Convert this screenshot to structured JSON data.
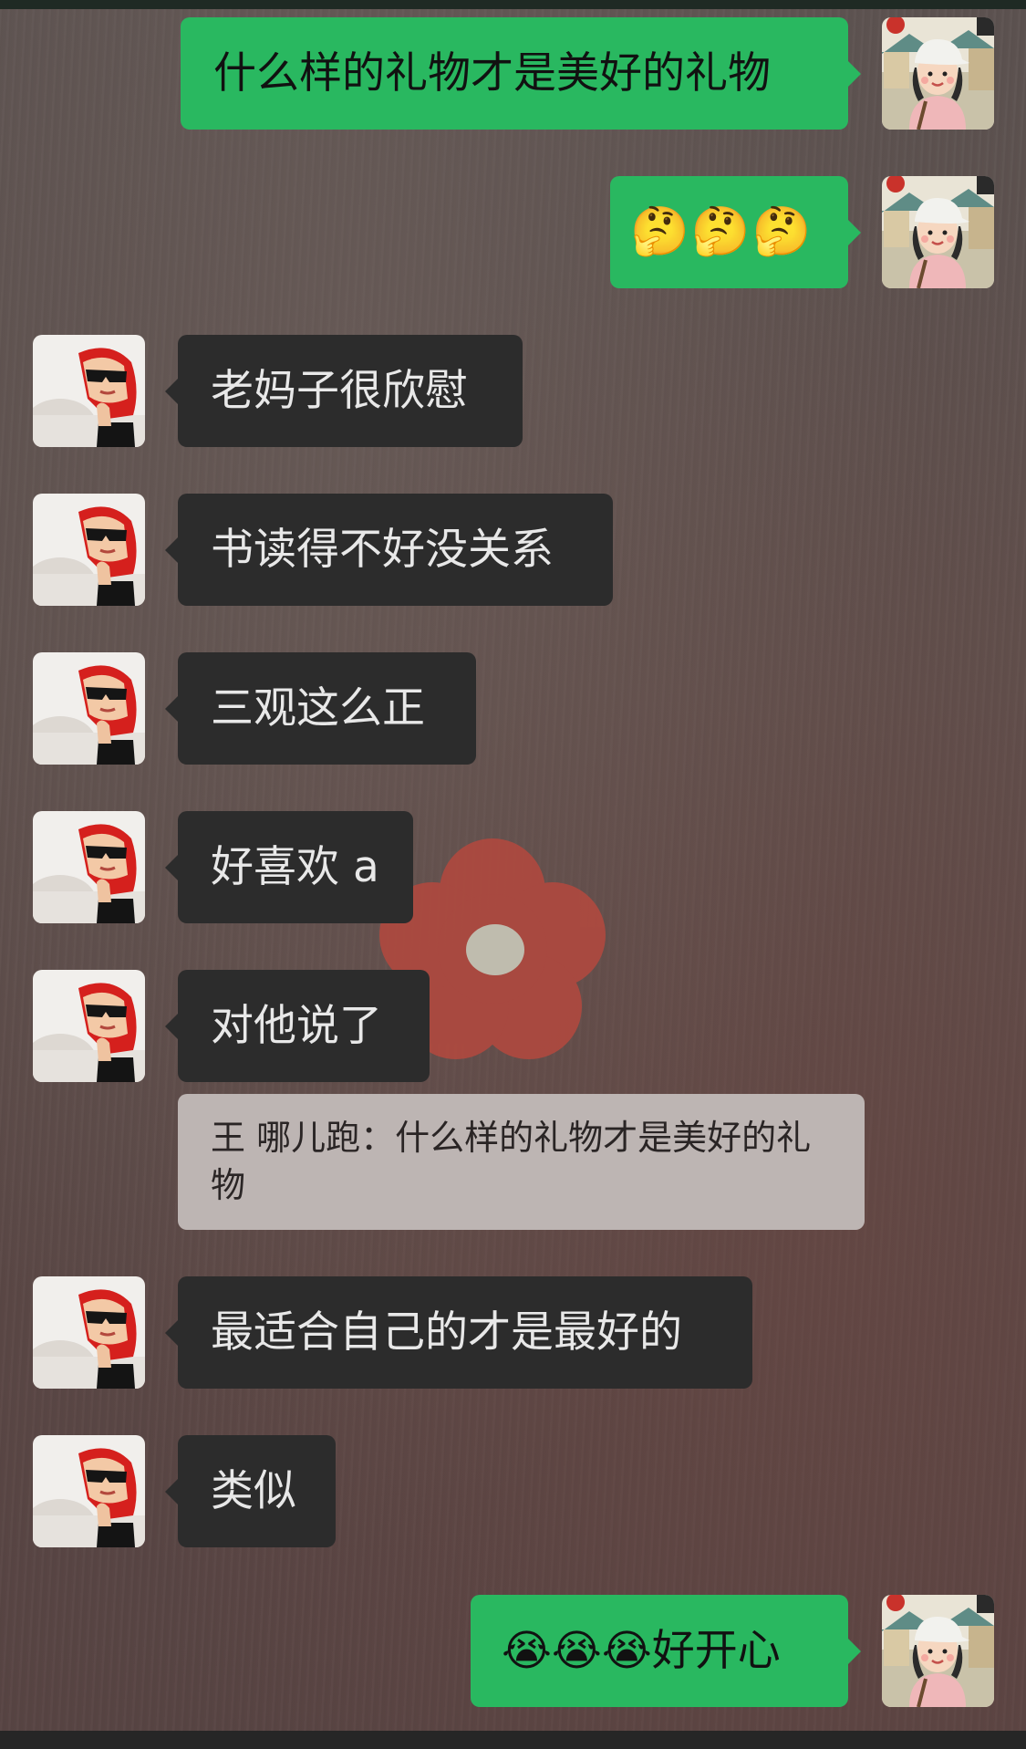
{
  "messages": [
    {
      "side": "me",
      "text": "什么样的礼物才是美好的礼物"
    },
    {
      "side": "me",
      "text": "🤔🤔🤔"
    },
    {
      "side": "them",
      "text": "老妈子很欣慰"
    },
    {
      "side": "them",
      "text": "书读得不好没关系"
    },
    {
      "side": "them",
      "text": "三观这么正"
    },
    {
      "side": "them",
      "text": "好喜欢 a"
    },
    {
      "side": "them",
      "text": "对他说了"
    },
    {
      "side": "them",
      "text": "最适合自己的才是最好的"
    },
    {
      "side": "them",
      "text": "类似"
    },
    {
      "side": "me",
      "text": "😭😭😭好开心"
    }
  ],
  "quote": {
    "text": "王 哪儿跑：什么样的礼物才是美好的礼物"
  },
  "colors": {
    "my_bubble": "#29b860",
    "their_bubble": "#2c2c2c",
    "quote_bg": "#bdb5b3"
  },
  "avatars": {
    "me": "cartoon-girl-avatar",
    "them": "red-hood-child-avatar"
  }
}
